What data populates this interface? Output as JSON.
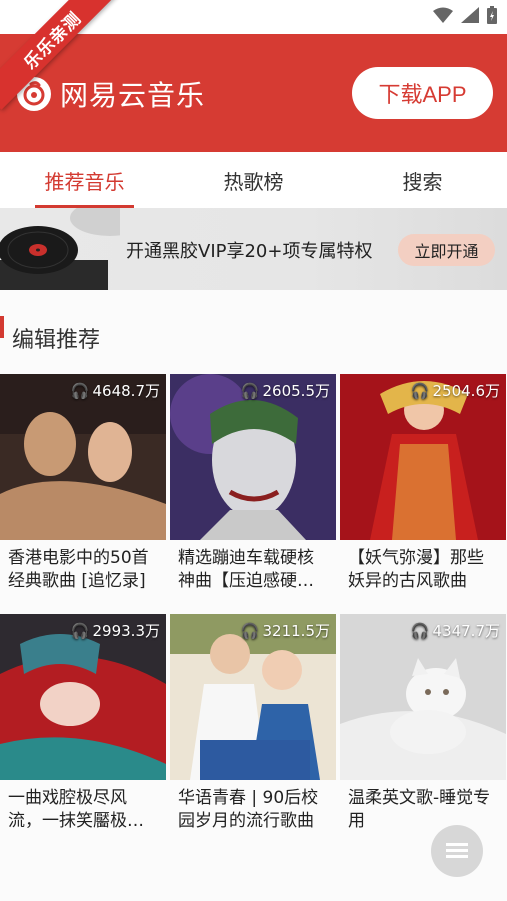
{
  "ribbon": {
    "label": "乐乐亲测"
  },
  "header": {
    "brand": "网易云音乐",
    "download_button": "下载APP"
  },
  "tabs": [
    {
      "label": "推荐音乐",
      "active": true
    },
    {
      "label": "热歌榜",
      "active": false
    },
    {
      "label": "搜索",
      "active": false
    }
  ],
  "vip_banner": {
    "text": "开通黑胶VIP享20+项专属特权",
    "button": "立即开通"
  },
  "section": {
    "title": "编辑推荐"
  },
  "playlists": [
    {
      "plays": "4648.7万",
      "title": "香港电影中的50首经典歌曲 [追忆录]"
    },
    {
      "plays": "2605.5万",
      "title": "精选蹦迪车载硬核神曲【压迫感硬…"
    },
    {
      "plays": "2504.6万",
      "title": "【妖气弥漫】那些妖异的古风歌曲"
    },
    {
      "plays": "2993.3万",
      "title": "一曲戏腔极尽风流，一抹笑靨极…"
    },
    {
      "plays": "3211.5万",
      "title": "华语青春 | 90后校园岁月的流行歌曲"
    },
    {
      "plays": "4347.7万",
      "title": "温柔英文歌-睡觉专用"
    }
  ],
  "colors": {
    "brand_red": "#d63b33",
    "tab_active": "#d33a31",
    "vip_button": "#f3cfc2"
  }
}
